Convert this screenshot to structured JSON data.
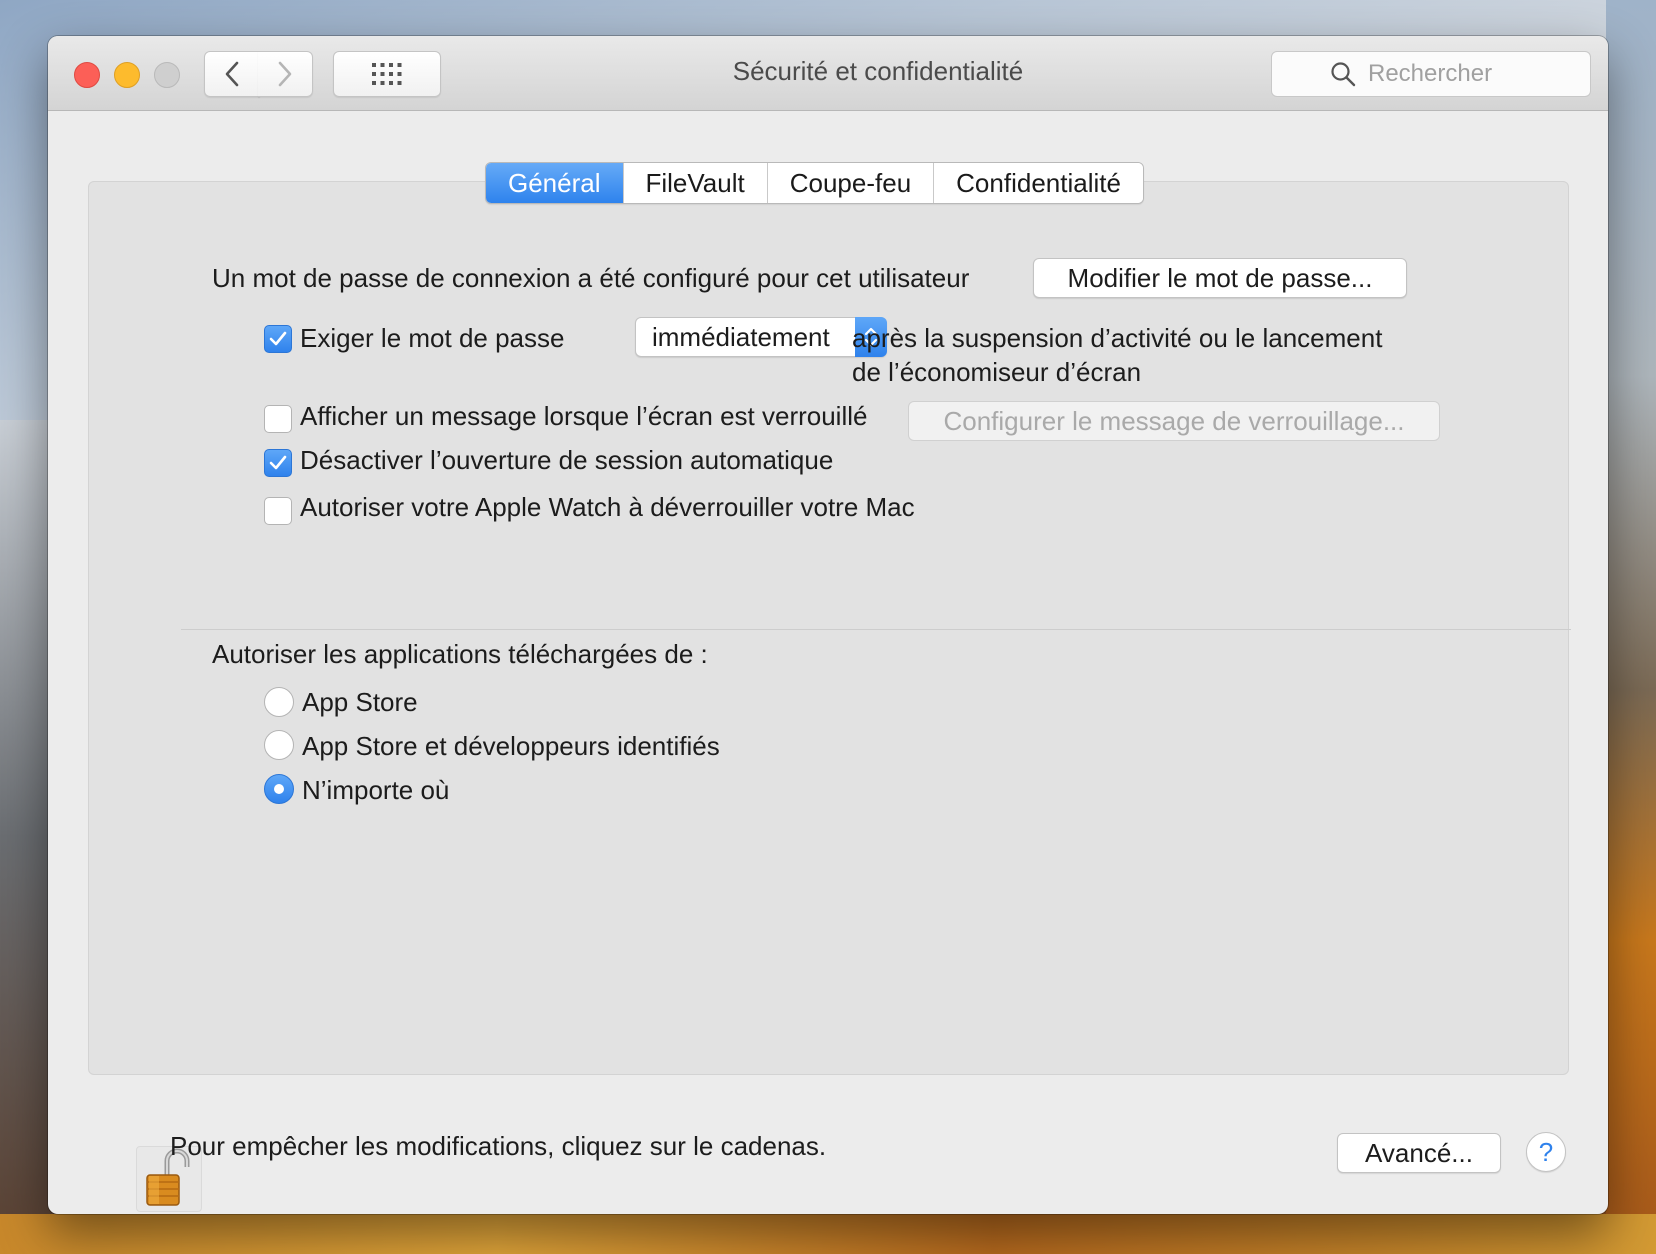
{
  "window": {
    "title": "Sécurité et confidentialité",
    "search_placeholder": "Rechercher"
  },
  "tabs": [
    {
      "label": "Général",
      "active": true
    },
    {
      "label": "FileVault",
      "active": false
    },
    {
      "label": "Coupe-feu",
      "active": false
    },
    {
      "label": "Confidentialité",
      "active": false
    }
  ],
  "general": {
    "password_info": "Un mot de passe de connexion a été configuré pour cet utilisateur",
    "change_password_button": "Modifier le mot de passe...",
    "require_password": {
      "label": "Exiger le mot de passe",
      "checked": true
    },
    "require_password_delay": "immédiatement",
    "after_text_line1": "après la suspension d’activité ou le lancement",
    "after_text_line2": "de l’économiseur d’écran",
    "show_message": {
      "label": "Afficher un message lorsque l’écran est verrouillé",
      "checked": false
    },
    "set_lock_message_button": "Configurer le message de verrouillage...",
    "disable_auto_login": {
      "label": "Désactiver l’ouverture de session automatique",
      "checked": true
    },
    "apple_watch_unlock": {
      "label": "Autoriser votre Apple Watch à déverrouiller votre Mac",
      "checked": false
    }
  },
  "downloads": {
    "heading": "Autoriser les applications téléchargées de :",
    "options": [
      {
        "label": "App Store",
        "selected": false
      },
      {
        "label": "App Store et développeurs identifiés",
        "selected": false
      },
      {
        "label": "N’importe où",
        "selected": true
      }
    ]
  },
  "footer": {
    "lock_text": "Pour empêcher les modifications, cliquez sur le cadenas.",
    "advanced_button": "Avancé...",
    "help_label": "?"
  },
  "colors": {
    "accent": "#2f82ec",
    "close": "#fc5f57",
    "minimize": "#fdbb2d",
    "zoom_disabled": "#cfcfcf"
  }
}
